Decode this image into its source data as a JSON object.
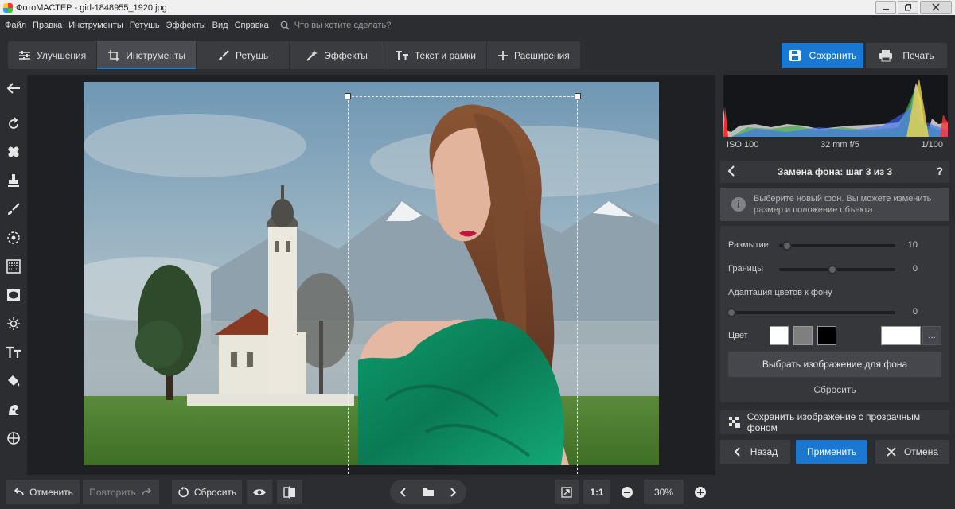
{
  "window": {
    "title": "ФотоМАСТЕР - girl-1848955_1920.jpg",
    "controls": [
      "minimize",
      "restore",
      "close"
    ]
  },
  "menu": {
    "items": [
      "Файл",
      "Правка",
      "Инструменты",
      "Ретушь",
      "Эффекты",
      "Вид",
      "Справка"
    ],
    "search_placeholder": "Что вы хотите сделать?"
  },
  "tabs": [
    {
      "label": "Улучшения",
      "icon": "sliders-icon",
      "active": false
    },
    {
      "label": "Инструменты",
      "icon": "crop-icon",
      "active": true
    },
    {
      "label": "Ретушь",
      "icon": "brush-icon",
      "active": false
    },
    {
      "label": "Эффекты",
      "icon": "magic-wand-icon",
      "active": false
    },
    {
      "label": "Текст и рамки",
      "icon": "text-icon",
      "active": false
    },
    {
      "label": "Расширения",
      "icon": "plus-icon",
      "active": false
    }
  ],
  "toolbar_right": {
    "save_label": "Сохранить",
    "print_label": "Печать"
  },
  "left_tools": [
    "back-arrow-icon",
    "rotate-icon",
    "healing-icon",
    "stamp-icon",
    "brush-icon",
    "target-icon",
    "gradient-icon",
    "vignette-icon",
    "light-icon",
    "text-icon",
    "fill-icon",
    "replace-bg-icon",
    "crosshair-icon"
  ],
  "histogram": {
    "iso": "ISO 100",
    "lens": "32 mm f/5",
    "shutter": "1/100"
  },
  "panel": {
    "title": "Замена фона: шаг 3 из 3",
    "help": "?",
    "info_line1": "Выберите новый фон. Вы можете изменить",
    "info_line2": "размер и положение объекта.",
    "info_icon": "i",
    "sliders": [
      {
        "label": "Размытие",
        "value": "10",
        "level": 0.07
      },
      {
        "label": "Границы",
        "value": "0",
        "level": 0.5
      },
      {
        "label": "Адаптация цветов к фону",
        "value": "0",
        "level": 0.0
      }
    ],
    "color_label": "Цвет",
    "swatches": [
      "#ffffff",
      "#7f7f7f",
      "#000000"
    ],
    "custom_color": "#ffffff",
    "more_label": "...",
    "pick_bg_label": "Выбрать изображение для фона",
    "reset_label": "Сбросить",
    "save_transparent_label": "Сохранить изображение с прозрачным фоном",
    "back_label": "Назад",
    "apply_label": "Применить",
    "cancel_label": "Отмена"
  },
  "bottom": {
    "undo_label": "Отменить",
    "redo_label": "Повторить",
    "reset_label": "Сбросить",
    "one_to_one": "1:1",
    "zoom": "30%"
  },
  "colors": {
    "accent": "#1b78d0",
    "background": "#2b2d30",
    "panel": "#35373b"
  }
}
